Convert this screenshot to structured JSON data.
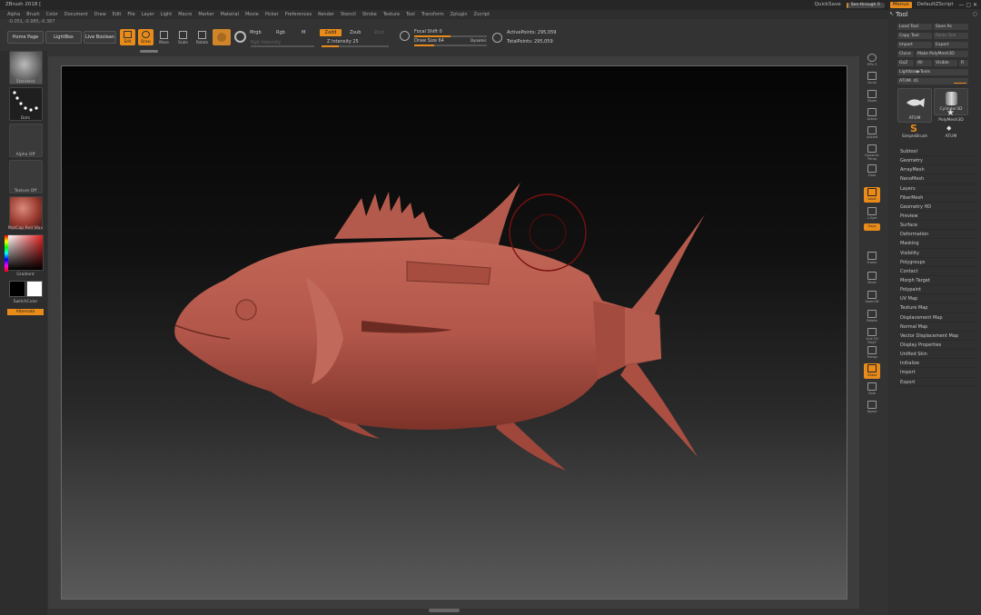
{
  "app": {
    "title": "ZBrush 2018 [",
    "coords": "-0.051,-0.985,-0.387"
  },
  "titlebar_right": {
    "quicksave": "QuickSave",
    "seethrough": "See-through  0",
    "seethrough_value": 0,
    "menu": "Menus",
    "zscript": "DefaultZScript"
  },
  "menus": [
    "Alpha",
    "Brush",
    "Color",
    "Document",
    "Draw",
    "Edit",
    "File",
    "Layer",
    "Light",
    "Macro",
    "Marker",
    "Material",
    "Movie",
    "Picker",
    "Preferences",
    "Render",
    "Stencil",
    "Stroke",
    "Texture",
    "Tool",
    "Transform",
    "Zplugin",
    "Zscript"
  ],
  "shelf": {
    "home": "Home Page",
    "lightbox": "LightBox",
    "liveboolean": "Live Boolean",
    "edit": "Edit",
    "draw": "Draw",
    "move": "Move",
    "scale": "Scale",
    "rotate": "Rotate",
    "mrgb": "Mrgb",
    "rgb": "Rgb",
    "m": "M",
    "rgb_intensity": "Rgb Intensity",
    "zadd": "Zadd",
    "zsub": "Zsub",
    "zcut": "Zcut",
    "z_intensity": "Z Intensity 25",
    "focal_shift": "Focal Shift 0",
    "draw_size": "Draw Size 64",
    "dynamic": "Dynamic",
    "active_points": "ActivePoints: 295,059",
    "total_points": "TotalPoints: 295,059"
  },
  "left": {
    "brush": "Standard",
    "stroke": "Dots",
    "alpha": "Alpha Off",
    "texture": "Texture Off",
    "material": "MatCap Red Wax",
    "gradient": "Gradient",
    "switchcolor": "SwitchColor",
    "alternate": "Alternate"
  },
  "right_shelf": [
    "SPix 3",
    "Scroll",
    "Zoom",
    "Actual",
    "AAHalf",
    "Dynamic Persp",
    "Floor",
    "Local",
    "L.Sym",
    "Gxyz",
    "Frame",
    "Move",
    "Zoom3D",
    "Rotate",
    "Line Fill PolyF",
    "Transp",
    "Ghost",
    "Solo",
    "Xpose"
  ],
  "tool": {
    "title": "Tool",
    "load": "Load Tool",
    "saveas": "Save As",
    "copy": "Copy Tool",
    "paste": "Paste Tool",
    "import": "Import",
    "export": "Export",
    "clone": "Clone",
    "make_polymesh": "Make PolyMesh3D",
    "goz": "GoZ",
    "all": "All",
    "visible": "Visible",
    "r": "R",
    "lightbox_tools": "Lightbox▶Tools",
    "atum": "ATUM. 41",
    "atum_value": 41,
    "thumbs": [
      "ATUM",
      "Cylinder3D",
      "PolyMesh3D",
      "SimpleBrush",
      "ATUM"
    ],
    "subpalettes": [
      "Subtool",
      "Geometry",
      "ArrayMesh",
      "NanoMesh",
      "Layers",
      "FiberMesh",
      "Geometry HD",
      "Preview",
      "Surface",
      "Deformation",
      "Masking",
      "Visibility",
      "Polygroups",
      "Contact",
      "Morph Target",
      "Polypaint",
      "UV Map",
      "Texture Map",
      "Displacement Map",
      "Normal Map",
      "Vector Displacement Map",
      "Display Properties",
      "Unified Skin",
      "Initialize",
      "Import",
      "Export"
    ]
  },
  "colors": {
    "accent": "#e88b1b",
    "fish": "#b8574a"
  }
}
